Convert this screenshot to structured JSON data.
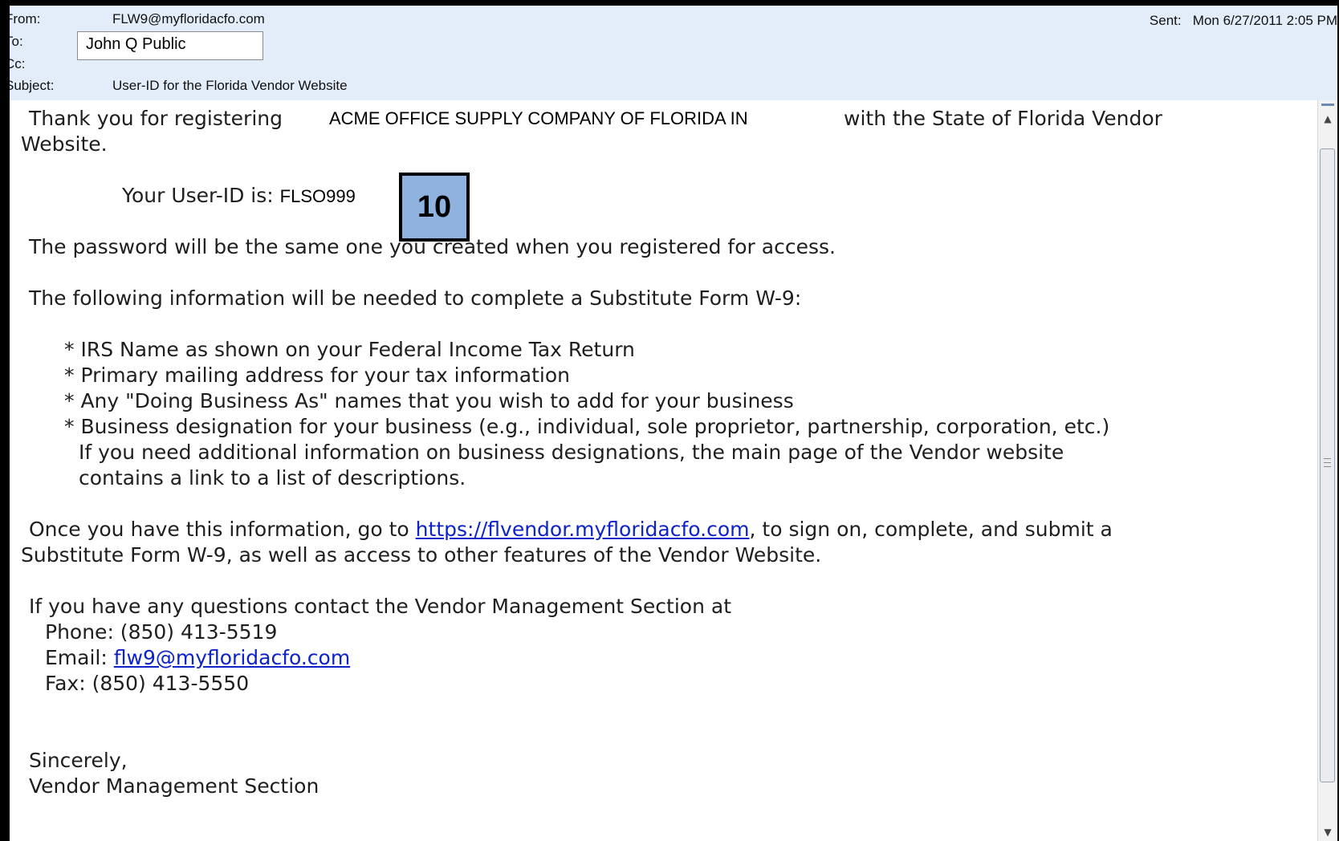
{
  "header": {
    "from_label": "From:",
    "from_value": "FLW9@myfloridacfo.com",
    "to_label": "To:",
    "to_value": "John Q Public",
    "cc_label": "Cc:",
    "subject_label": "Subject:",
    "subject_value": "User-ID for the Florida Vendor Website",
    "sent_label": "Sent:",
    "sent_value": "Mon 6/27/2011 2:05 PM"
  },
  "body": {
    "intro_pre": "Thank you for registering",
    "company_name": "ACME OFFICE SUPPLY COMPANY OF FLORIDA IN",
    "intro_post": "with the State of Florida Vendor",
    "intro_cont": "Website.",
    "userid_label": "Your User-ID is:",
    "userid_value": "FLSO999",
    "password_line": "The password will be the same one you created when you registered for access.",
    "w9_intro": "The following information will be needed to complete a Substitute Form W-9:",
    "bullets": [
      "* IRS Name as shown on your Federal Income Tax Return",
      "* Primary mailing address for your tax information",
      "* Any \"Doing Business As\" names that you wish to add for your business",
      "* Business designation for your business (e.g., individual, sole proprietor, partnership, corporation, etc.)"
    ],
    "bullet_note_1": "If you need additional information on business designations, the main page of the Vendor website",
    "bullet_note_2": "contains a link to a list of descriptions.",
    "once_pre": "Once you have this information, go to",
    "vendor_link": "https://flvendor.myfloridacfo.com",
    "once_post": ", to  sign on, complete, and submit a",
    "once_cont": "Substitute Form W-9, as  well as access to other features of the Vendor Website.",
    "questions": "If you have any questions contact the Vendor Management Section at",
    "phone": "Phone: (850) 413-5519",
    "email_label": "Email:",
    "email_link": "flw9@myfloridacfo.com",
    "fax": "Fax: (850) 413-5550",
    "sign_1": "Sincerely,",
    "sign_2": "Vendor Management Section"
  },
  "badge": {
    "number": "10",
    "color": "#8fb2df"
  },
  "icons": {
    "scroll_up": "scroll-up-arrow-icon",
    "scroll_down": "scroll-down-arrow-icon"
  }
}
